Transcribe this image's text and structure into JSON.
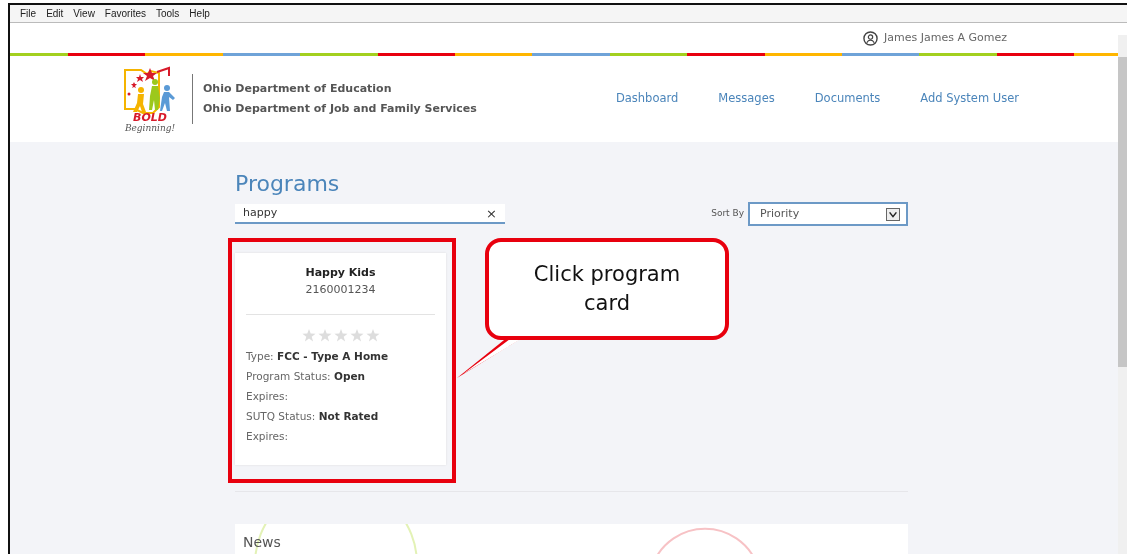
{
  "menu_bar": [
    "File",
    "Edit",
    "View",
    "Favorites",
    "Tools",
    "Help"
  ],
  "user": {
    "name": "James James A Gomez"
  },
  "logo": {
    "word": "BOLD",
    "tagline": "Beginning!"
  },
  "departments": [
    "Ohio Department of Education",
    "Ohio Department of Job and Family Services"
  ],
  "nav": [
    "Dashboard",
    "Messages",
    "Documents",
    "Add System User"
  ],
  "page_title": "Programs",
  "search": {
    "value": "happy",
    "clear": "×"
  },
  "sort": {
    "label": "Sort By",
    "value": "Priority"
  },
  "cards": [
    {
      "name": "Happy Kids",
      "number": "2160001234",
      "stars": 0,
      "fields": [
        {
          "label": "Type:",
          "value": "FCC - Type A Home"
        },
        {
          "label": "Program Status:",
          "value": "Open"
        },
        {
          "label": "Expires:"
        },
        {
          "label": "SUTQ Status:",
          "value": "Not Rated"
        },
        {
          "label": "Expires:"
        }
      ]
    }
  ],
  "news": {
    "title": "News"
  },
  "annotation": {
    "text": "Click program card"
  }
}
